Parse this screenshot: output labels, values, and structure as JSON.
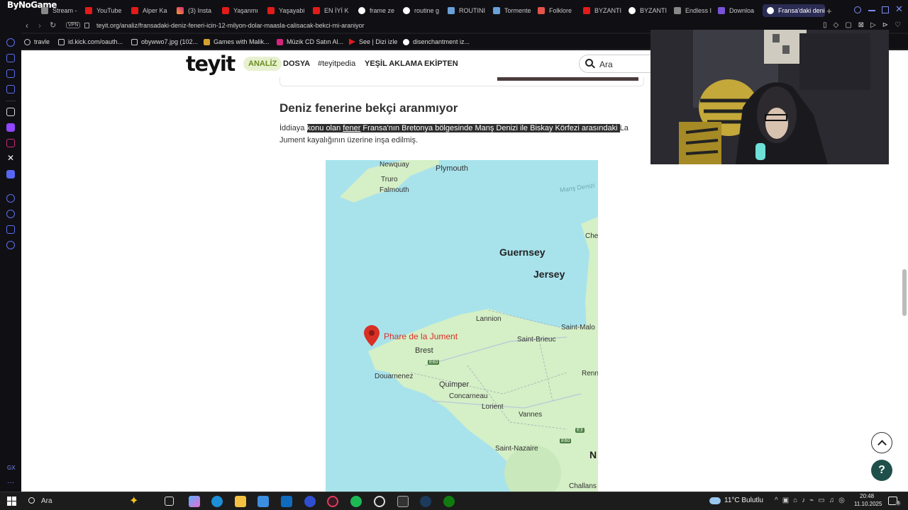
{
  "browser": {
    "brand": "ByNoGame",
    "tabs": [
      {
        "label": "Stream -",
        "icon": "stream-icon"
      },
      {
        "label": "YouTube",
        "icon": "youtube-icon"
      },
      {
        "label": "Alper Ka",
        "icon": "youtube-icon"
      },
      {
        "label": "(3) Insta",
        "icon": "instagram-icon"
      },
      {
        "label": "Yaşanmı",
        "icon": "youtube-icon"
      },
      {
        "label": "Yaşayabi",
        "icon": "youtube-icon"
      },
      {
        "label": "EN İYİ K",
        "icon": "youtube-icon"
      },
      {
        "label": "frame ze",
        "icon": "google-icon"
      },
      {
        "label": "routine g",
        "icon": "google-icon"
      },
      {
        "label": "ROUTINI",
        "icon": "steam-icon"
      },
      {
        "label": "Tormente",
        "icon": "steam-icon"
      },
      {
        "label": "Folklore",
        "icon": "folder-icon"
      },
      {
        "label": "BYZANTI",
        "icon": "youtube-icon"
      },
      {
        "label": "BYZANTI",
        "icon": "google-icon"
      },
      {
        "label": "Endless I",
        "icon": "page-icon"
      },
      {
        "label": "Downloa",
        "icon": "download-icon"
      },
      {
        "label": "Fransa'daki deniz",
        "icon": "globe-icon"
      }
    ],
    "vpn_label": "VPN",
    "url": "teyit.org/analiz/fransadaki-deniz-feneri-icin-12-milyon-dolar-maasla-calisacak-bekci-mi-araniyor",
    "bookmarks": [
      "travle",
      "id.kick.com/oauth...",
      "obywwo7.jpg (102...",
      "Games with Malik...",
      "Müzik CD Satın Al...",
      "See | Dizi izle",
      "disenchantment iz..."
    ]
  },
  "site": {
    "logo": "teyit",
    "nav": [
      "ANALİZ",
      "DOSYA",
      "#teyitpedia",
      "YEŞİL AKLAMA",
      "EKİPTEN"
    ],
    "search_placeholder": "Ara"
  },
  "article": {
    "heading": "Deniz fenerine bekçi aranmıyor",
    "para_start": "İddiaya ",
    "para_hl_1": "konu olan ",
    "para_hl_link": "fener",
    "para_hl_2": " Fransa'nın Bretonya bölgesinde Manş Denizi ile Biskay Körfezi arasındaki ",
    "para_end": "La Jument kayalığının üzerine inşa edilmiş."
  },
  "map": {
    "pin_label": "Phare de la Jument",
    "labels": [
      "Newquay",
      "Plymouth",
      "Truro",
      "Falmouth",
      "Manş Denizi",
      "Che",
      "Guernsey",
      "Jersey",
      "Lannion",
      "Saint-Malo",
      "Saint-Brieuc",
      "Brest",
      "E60",
      "Renn",
      "Douarnenez",
      "Quimper",
      "Concarneau",
      "Lorient",
      "Vannes",
      "E3",
      "E60",
      "Saint-Nazaire",
      "N",
      "Challans"
    ],
    "colors": {
      "sea": "#a8e3ec",
      "land": "#d5efc6",
      "pin": "#d93025"
    }
  },
  "taskbar": {
    "search_label": "Ara",
    "weather": "11°C  Bulutlu",
    "time": "20:48",
    "date": "11.10.2025",
    "notif_count": "8"
  }
}
